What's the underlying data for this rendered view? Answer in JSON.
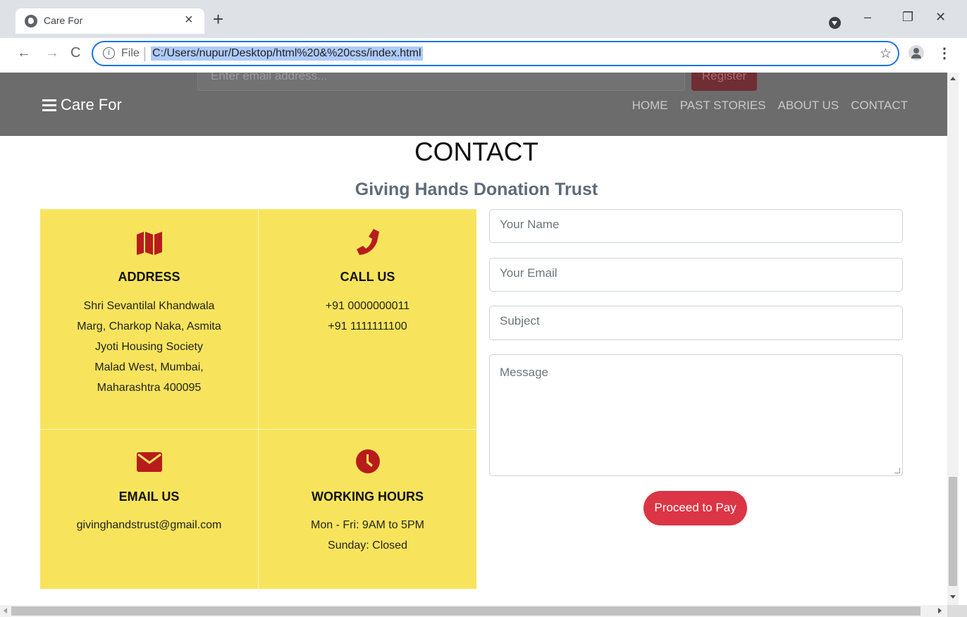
{
  "browser": {
    "tab_title": "Care For",
    "tab_close": "×",
    "new_tab": "+",
    "file_label": "File",
    "url": "C:/Users/nupur/Desktop/html%20&%20css/index.html",
    "win_minimize": "–",
    "win_restore": "❐",
    "win_close": "✕",
    "back": "←",
    "forward": "→",
    "reload": "C",
    "star": "☆",
    "menu": "⋮"
  },
  "header": {
    "email_placeholder": "Enter email address...",
    "register_label": "Register",
    "brand": "Care For",
    "nav": [
      "HOME",
      "PAST STORIES",
      "ABOUT US",
      "CONTACT"
    ]
  },
  "contact": {
    "title": "CONTACT",
    "subtitle": "Giving Hands Donation Trust",
    "address": {
      "icon": "map-icon",
      "heading": "ADDRESS",
      "lines": [
        "Shri Sevantilal Khandwala",
        "Marg, Charkop Naka, Asmita",
        "Jyoti Housing Society",
        "Malad West, Mumbai,",
        "Maharashtra 400095"
      ]
    },
    "call": {
      "icon": "phone-icon",
      "heading": "CALL US",
      "lines": [
        "+91 0000000011",
        "+91 1111111100"
      ]
    },
    "email": {
      "icon": "envelope-icon",
      "heading": "EMAIL US",
      "lines": [
        "givinghandstrust@gmail.com"
      ]
    },
    "hours": {
      "icon": "clock-icon",
      "heading": "WORKING HOURS",
      "lines": [
        "Mon - Fri: 9AM to 5PM",
        "Sunday: Closed"
      ]
    }
  },
  "form": {
    "name_placeholder": "Your Name",
    "email_placeholder": "Your Email",
    "subject_placeholder": "Subject",
    "message_placeholder": "Message",
    "submit_label": "Proceed to Pay"
  },
  "colors": {
    "accent_red": "#b71c1c",
    "card_yellow": "#f8e45c",
    "button_red": "#dc3545",
    "header_gray": "#6c6c6c"
  }
}
